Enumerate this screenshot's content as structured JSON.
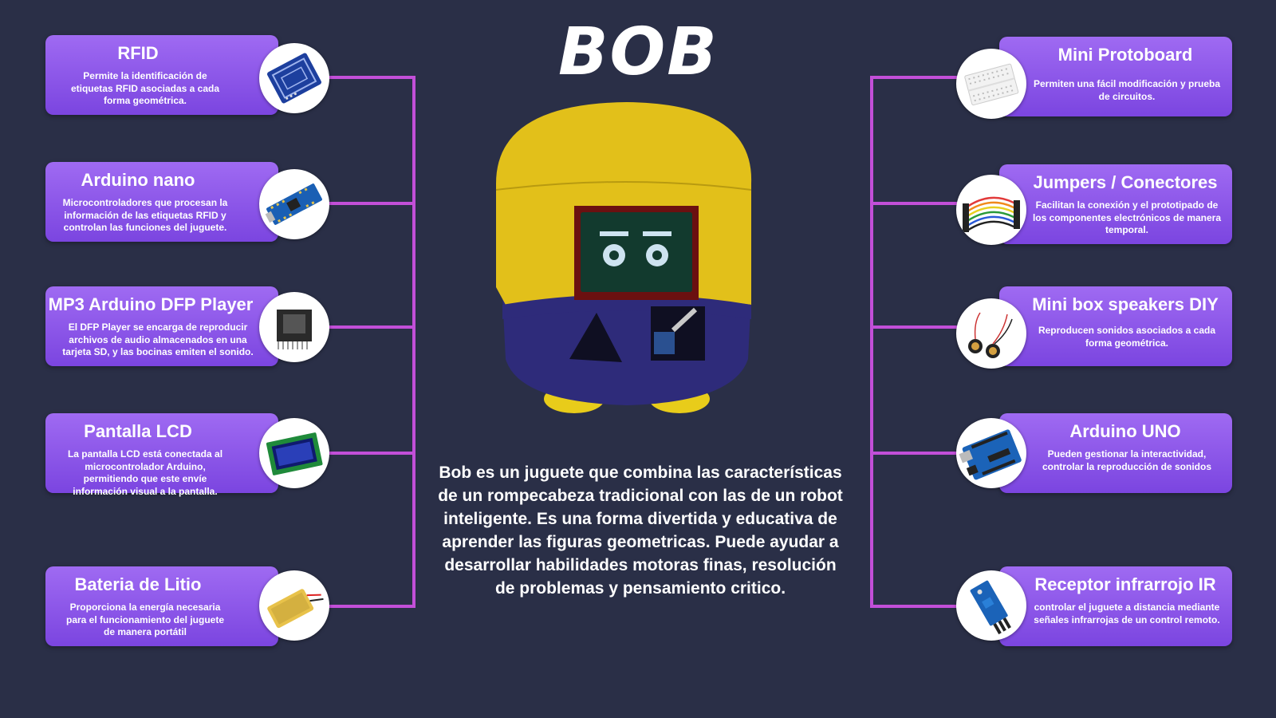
{
  "title": "BOB",
  "description": "Bob es un juguete que combina las características de un rompecabeza tradicional con las de un robot inteligente.  Es una forma divertida y educativa de aprender las figuras geometricas. Puede ayudar a desarrollar habilidades motoras finas, resolución de problemas y pensamiento critico.",
  "accent_color": "#c24fd8",
  "left": [
    {
      "title": "RFID",
      "desc": "Permite la identificación de etiquetas RFID asociadas a cada forma geométrica.",
      "icon": "rfid-module-icon"
    },
    {
      "title": "Arduino nano",
      "desc": "Microcontroladores que procesan la información de las etiquetas RFID y controlan las funciones del juguete.",
      "icon": "arduino-nano-icon"
    },
    {
      "title": "MP3 Arduino DFP Player",
      "desc": "El DFP Player se encarga de reproducir archivos de audio almacenados en una tarjeta SD, y las bocinas emiten el sonido.",
      "icon": "dfplayer-icon"
    },
    {
      "title": "Pantalla LCD",
      "desc": "La pantalla LCD está conectada al microcontrolador Arduino, permitiendo que este envíe información visual a la pantalla.",
      "icon": "lcd-screen-icon"
    },
    {
      "title": "Bateria de Litio",
      "desc": "Proporciona la energía necesaria para el funcionamiento del juguete de manera portátil",
      "icon": "lithium-battery-icon"
    }
  ],
  "right": [
    {
      "title": "Mini Protoboard",
      "desc": "Permiten una fácil modificación y prueba de circuitos.",
      "icon": "protoboard-icon"
    },
    {
      "title": "Jumpers / Conectores",
      "desc": "Facilitan la conexión y el prototipado de los componentes electrónicos de manera temporal.",
      "icon": "jumper-wires-icon"
    },
    {
      "title": "Mini box speakers DIY",
      "desc": "Reproducen sonidos asociados a cada forma geométrica.",
      "icon": "speaker-icon"
    },
    {
      "title": "Arduino UNO",
      "desc": "Pueden gestionar la interactividad, controlar la reproducción de sonidos",
      "icon": "arduino-uno-icon"
    },
    {
      "title": "Receptor  infrarrojo IR",
      "desc": "controlar el juguete a distancia mediante señales infrarrojas de un control remoto.",
      "icon": "ir-receiver-icon"
    }
  ]
}
